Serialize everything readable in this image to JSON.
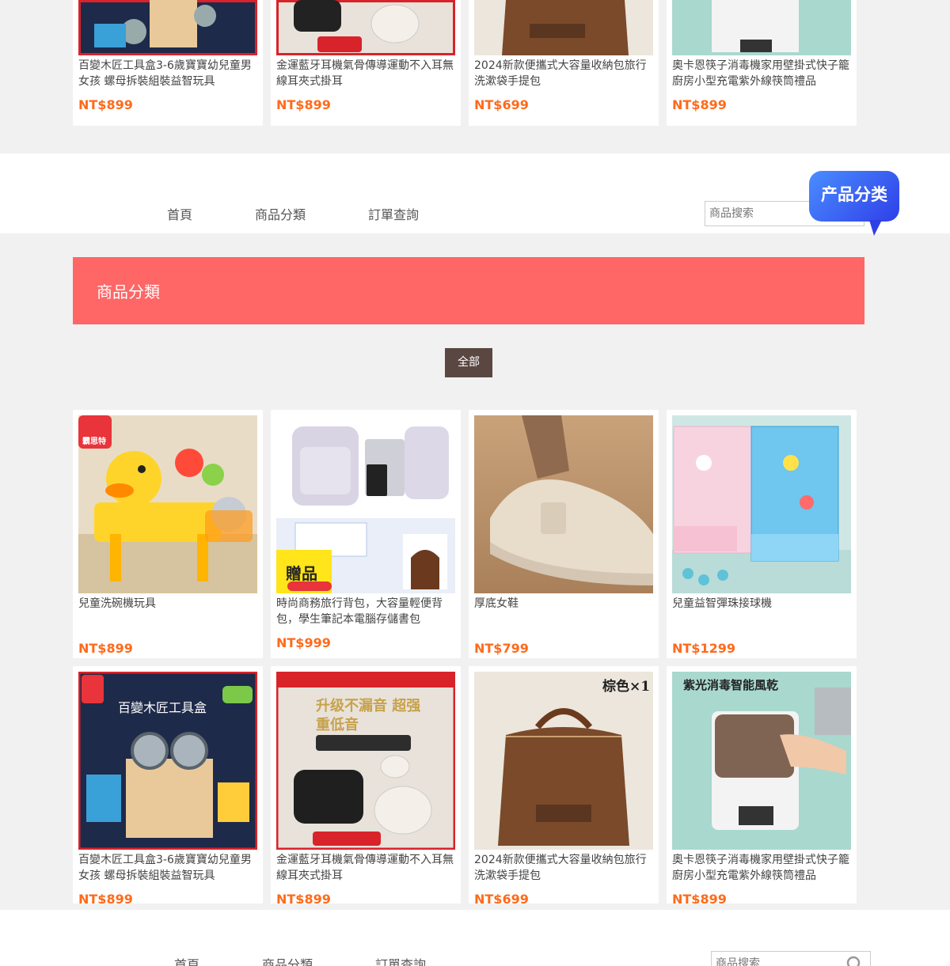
{
  "top_products": [
    {
      "title": "百變木匠工具盒3-6歲寶寶幼兒童男女孩 螺母拆裝組裝益智玩具",
      "price": "NT$899"
    },
    {
      "title": "金運藍牙耳機氣骨傳導運動不入耳無線耳夾式掛耳",
      "price": "NT$899"
    },
    {
      "title": "2024新款便攜式大容量收納包旅行洗漱袋手提包",
      "price": "NT$699"
    },
    {
      "title": "奧卡恩筷子消毒機家用壁掛式快子籠廚房小型充電紫外線筷筒禮品",
      "price": "NT$899"
    }
  ],
  "nav": {
    "items": [
      "首頁",
      "商品分類",
      "訂單查詢"
    ],
    "search_placeholder": "商品搜索"
  },
  "badge": "产品分类",
  "banner_title": "商品分類",
  "filter_all": "全部",
  "products": [
    {
      "title": "兒童洗碗機玩具",
      "price": "NT$899",
      "tag": "霸思特"
    },
    {
      "title": "時尚商務旅行背包，大容量輕便背包，學生筆記本電腦存儲書包",
      "price": "NT$999",
      "tag": "贈品"
    },
    {
      "title": "厚底女鞋",
      "price": "NT$799"
    },
    {
      "title": "兒童益智彈珠接球機",
      "price": "NT$1299"
    },
    {
      "title": "百變木匠工具盒3-6歲寶寶幼兒童男女孩 螺母拆裝組裝益智玩具",
      "price": "NT$899",
      "tag": "百變木匠工具盒"
    },
    {
      "title": "金運藍牙耳機氣骨傳導運動不入耳無線耳夾式掛耳",
      "price": "NT$899",
      "tag": "升级不漏音 超强重低音"
    },
    {
      "title": "2024新款便攜式大容量收納包旅行洗漱袋手提包",
      "price": "NT$699",
      "tag": "棕色×1"
    },
    {
      "title": "奧卡恩筷子消毒機家用壁掛式快子籠廚房小型充電紫外線筷筒禮品",
      "price": "NT$899",
      "tag": "紫光消毒智能風乾"
    }
  ],
  "footer_nav": {
    "items": [
      "首頁",
      "商品分類",
      "訂單查詢"
    ],
    "search_placeholder": "商品搜索"
  }
}
